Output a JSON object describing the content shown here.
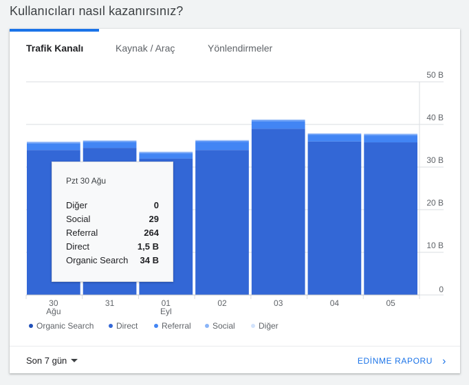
{
  "heading": "Kullanıcıları nasıl kazanırsınız?",
  "tabs": [
    {
      "label": "Trafik Kanalı",
      "active": true
    },
    {
      "label": "Kaynak / Araç",
      "active": false
    },
    {
      "label": "Yönlendirmeler",
      "active": false
    }
  ],
  "chart_data": {
    "type": "bar",
    "stacked": true,
    "categories": [
      "30 Ağu",
      "31",
      "01 Eyl",
      "02",
      "03",
      "04",
      "05"
    ],
    "x_tick_labels": [
      [
        "30",
        "Ağu"
      ],
      [
        "31"
      ],
      [
        "01",
        "Eyl"
      ],
      [
        "02"
      ],
      [
        "03"
      ],
      [
        "04"
      ],
      [
        "05"
      ]
    ],
    "y_tick_labels": [
      "0",
      "10 B",
      "20 B",
      "30 B",
      "40 B",
      "50 B"
    ],
    "ylim": [
      0,
      50000
    ],
    "grid": true,
    "legend_position": "bottom",
    "series": [
      {
        "name": "Organic Search",
        "color": "#3367d6",
        "values": [
          34000,
          34500,
          32000,
          34000,
          39000,
          36000,
          35800
        ]
      },
      {
        "name": "Direct",
        "color": "#4285f4",
        "values": [
          1500,
          1300,
          1200,
          1900,
          1700,
          1500,
          1600
        ]
      },
      {
        "name": "Referral",
        "color": "#5e97f6",
        "values": [
          264,
          250,
          220,
          240,
          280,
          230,
          240
        ]
      },
      {
        "name": "Social",
        "color": "#9fc0f8",
        "values": [
          29,
          25,
          22,
          30,
          27,
          24,
          26
        ]
      },
      {
        "name": "Diğer",
        "color": "#c6dafc",
        "values": [
          0,
          0,
          0,
          0,
          0,
          0,
          0
        ]
      }
    ]
  },
  "tooltip": {
    "title": "Pzt 30 Ağu",
    "rows": [
      {
        "name": "Diğer",
        "value": "0"
      },
      {
        "name": "Social",
        "value": "29"
      },
      {
        "name": "Referral",
        "value": "264"
      },
      {
        "name": "Direct",
        "value": "1,5 B"
      },
      {
        "name": "Organic Search",
        "value": "34 B"
      }
    ]
  },
  "footer": {
    "date_range": "Son 7 gün",
    "report_link": "EDİNME RAPORU",
    "report_icon": "chevron-right-icon"
  }
}
